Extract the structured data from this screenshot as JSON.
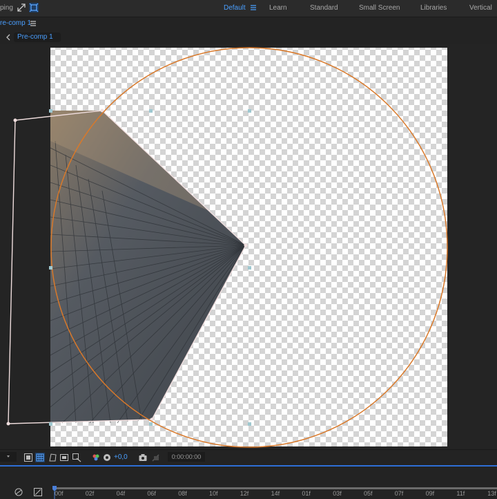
{
  "topbar": {
    "left_label": "ping",
    "workspaces": {
      "default": "Default",
      "learn": "Learn",
      "standard": "Standard",
      "small_screen": "Small Screen",
      "libraries": "Libraries",
      "vertical": "Vertical"
    }
  },
  "tab": {
    "label": "re-comp 1"
  },
  "nav": {
    "comp_label": "Pre-comp 1"
  },
  "viewer_toolbar": {
    "exposure_value": "+0,0",
    "timecode": "0:00:00:00"
  },
  "timeline": {
    "ruler_labels": [
      "00f",
      "02f",
      "04f",
      "06f",
      "08f",
      "10f",
      "12f",
      "14f",
      "01f",
      "03f",
      "05f",
      "07f",
      "09f",
      "11f",
      "13f"
    ]
  },
  "colors": {
    "accent": "#4a9fff",
    "mask_ellipse": "#d9792a",
    "panel_bg": "#232323",
    "handle": "#9fc8d0"
  }
}
